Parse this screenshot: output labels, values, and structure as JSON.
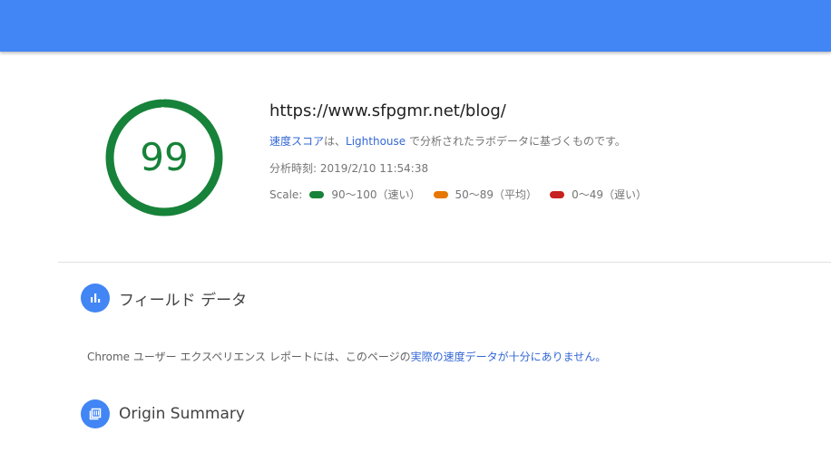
{
  "header": {
    "brand_color": "#4285f4"
  },
  "summary": {
    "score": "99",
    "score_value": 99,
    "score_color": "#178239",
    "url": "https://www.sfpgmr.net/blog/",
    "description": {
      "link1": "速度スコア",
      "text1": "は、",
      "link2": "Lighthouse",
      "text2": " で分析されたラボデータに基づくものです。"
    },
    "analysis_time": "分析時刻: 2019/2/10 11:54:38",
    "scale": {
      "label": "Scale:",
      "items": [
        {
          "text": "90〜100（速い）",
          "color": "#178239"
        },
        {
          "text": "50〜89（平均）",
          "color": "#e67700"
        },
        {
          "text": "0〜49（遅い）",
          "color": "#c7221f"
        }
      ]
    }
  },
  "field_data": {
    "title": "フィールド データ",
    "icon": "bar-chart-icon",
    "message_prefix": "Chrome ユーザー エクスペリエンス レポートには、このページの",
    "message_link": "実際の速度データが十分にありません。"
  },
  "origin_summary": {
    "title": "Origin Summary",
    "icon": "library-icon"
  }
}
